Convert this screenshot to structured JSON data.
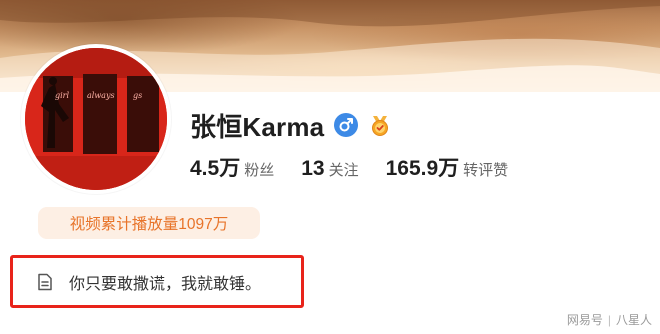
{
  "profile": {
    "name": "张恒Karma",
    "gender_icon": "male-symbol-icon",
    "badge_icon": "verified-medal-icon",
    "avatar_art_text": [
      "girl",
      "always",
      "gs"
    ]
  },
  "stats": [
    {
      "value": "4.5万",
      "label": "粉丝"
    },
    {
      "value": "13",
      "label": "关注"
    },
    {
      "value": "165.9万",
      "label": "转评赞"
    }
  ],
  "video_views": "视频累计播放量1097万",
  "bio": {
    "icon": "document-icon",
    "text": "你只要敢撒谎，我就敢锤。"
  },
  "watermark": {
    "source": "网易号",
    "author": "八星人"
  },
  "colors": {
    "accent_orange": "#e8742a",
    "pill_bg": "#fdefe4",
    "highlight_red": "#e8231a",
    "gender_blue": "#3d8ae6"
  }
}
